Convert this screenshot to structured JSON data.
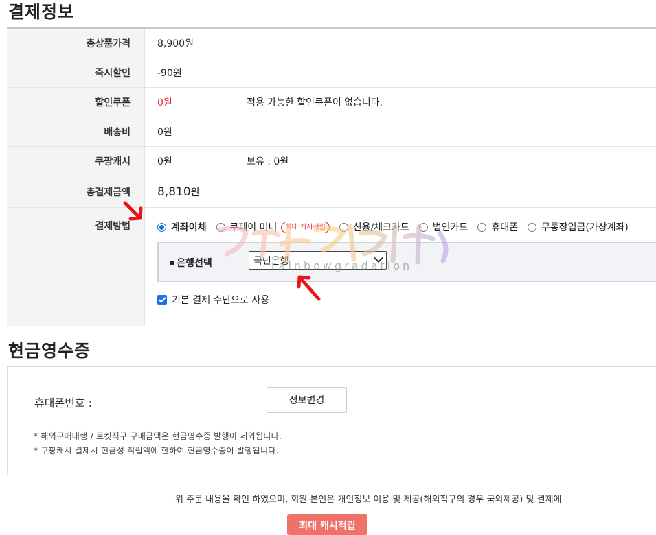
{
  "payment": {
    "title": "결제정보",
    "rows": {
      "product_price": {
        "label": "총상품가격",
        "value": "8,900원"
      },
      "instant_discount": {
        "label": "즉시할인",
        "value": "-90원"
      },
      "coupon": {
        "label": "할인쿠폰",
        "value": "0원",
        "note": "적용 가능한 할인쿠폰이 없습니다."
      },
      "shipping": {
        "label": "배송비",
        "value": "0원"
      },
      "cash": {
        "label": "쿠팡캐시",
        "value": "0원",
        "note": "보유 : 0원"
      },
      "total": {
        "label": "총결제금액",
        "value": "8,810",
        "unit": "원"
      }
    },
    "method": {
      "label": "결제방법",
      "options": [
        {
          "label": "계좌이체",
          "selected": true
        },
        {
          "label": "쿠페이 머니",
          "badge": "최대 캐시적립"
        },
        {
          "label": "신용/체크카드"
        },
        {
          "label": "법인카드"
        },
        {
          "label": "휴대폰"
        },
        {
          "label": "무통장입금(가상계좌)"
        }
      ],
      "bank_label": "은행선택",
      "bank_selected": "국민은행",
      "default_label": "기본 결제 수단으로 사용"
    }
  },
  "receipt": {
    "title": "현금영수증",
    "phone_label": "휴대폰번호 :",
    "change_button": "정보변경",
    "notes": [
      "* 해외구매대행 / 로켓직구 구매금액은 현금영수증 발행이 제외됩니다.",
      "* 쿠팡캐시 결제시 현금성 적립액에 한하여 현금영수증이 발행됩니다."
    ]
  },
  "agreement_text": "위 주문 내용을 확인 하였으며, 회원 본인은 개인정보 이용 및 제공(해외직구의 경우 국외제공) 및 결제에",
  "bottom_button": "최대 캐시적립",
  "watermark": {
    "sub": "rainbowgradation"
  },
  "colors": {
    "accent_blue": "#1a73e8",
    "red": "#e52528",
    "arrow": "#e8141b"
  }
}
